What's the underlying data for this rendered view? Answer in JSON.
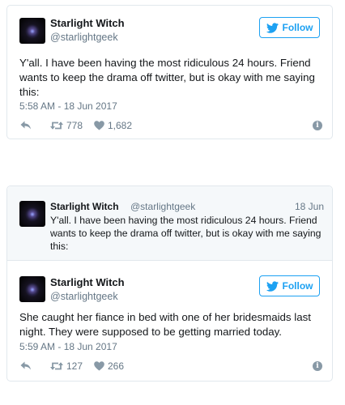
{
  "tweet1": {
    "name": "Starlight Witch",
    "handle": "@starlightgeek",
    "follow_label": "Follow",
    "text": "Y'all. I have been having the most ridiculous 24 hours. Friend\nwants to keep the drama off twitter, but is okay with me saying\nthis:",
    "timestamp": "5:58 AM - 18 Jun 2017",
    "retweets": "778",
    "likes": "1,682",
    "icons": [
      "avatar",
      "twitter-bird-icon",
      "reply-icon",
      "retweet-icon",
      "heart-icon",
      "info-icon"
    ]
  },
  "tweet2": {
    "quoted": {
      "name": "Starlight Witch",
      "handle": "@starlightgeek",
      "date": "18 Jun",
      "text": "Y'all. I have been having the most ridiculous 24 hours. Friend\nwants to keep the drama off twitter, but is okay with me saying\nthis:"
    },
    "name": "Starlight Witch",
    "handle": "@starlightgeek",
    "follow_label": "Follow",
    "text": "She caught her fiance in bed with one of her bridesmaids last\nnight. They were supposed to be getting married today.",
    "timestamp": "5:59 AM - 18 Jun 2017",
    "retweets": "127",
    "likes": "266"
  },
  "colors": {
    "accent": "#1da1f2",
    "muted": "#657786",
    "border": "#e1e8ed",
    "quote_bg": "#f5f8fa"
  }
}
